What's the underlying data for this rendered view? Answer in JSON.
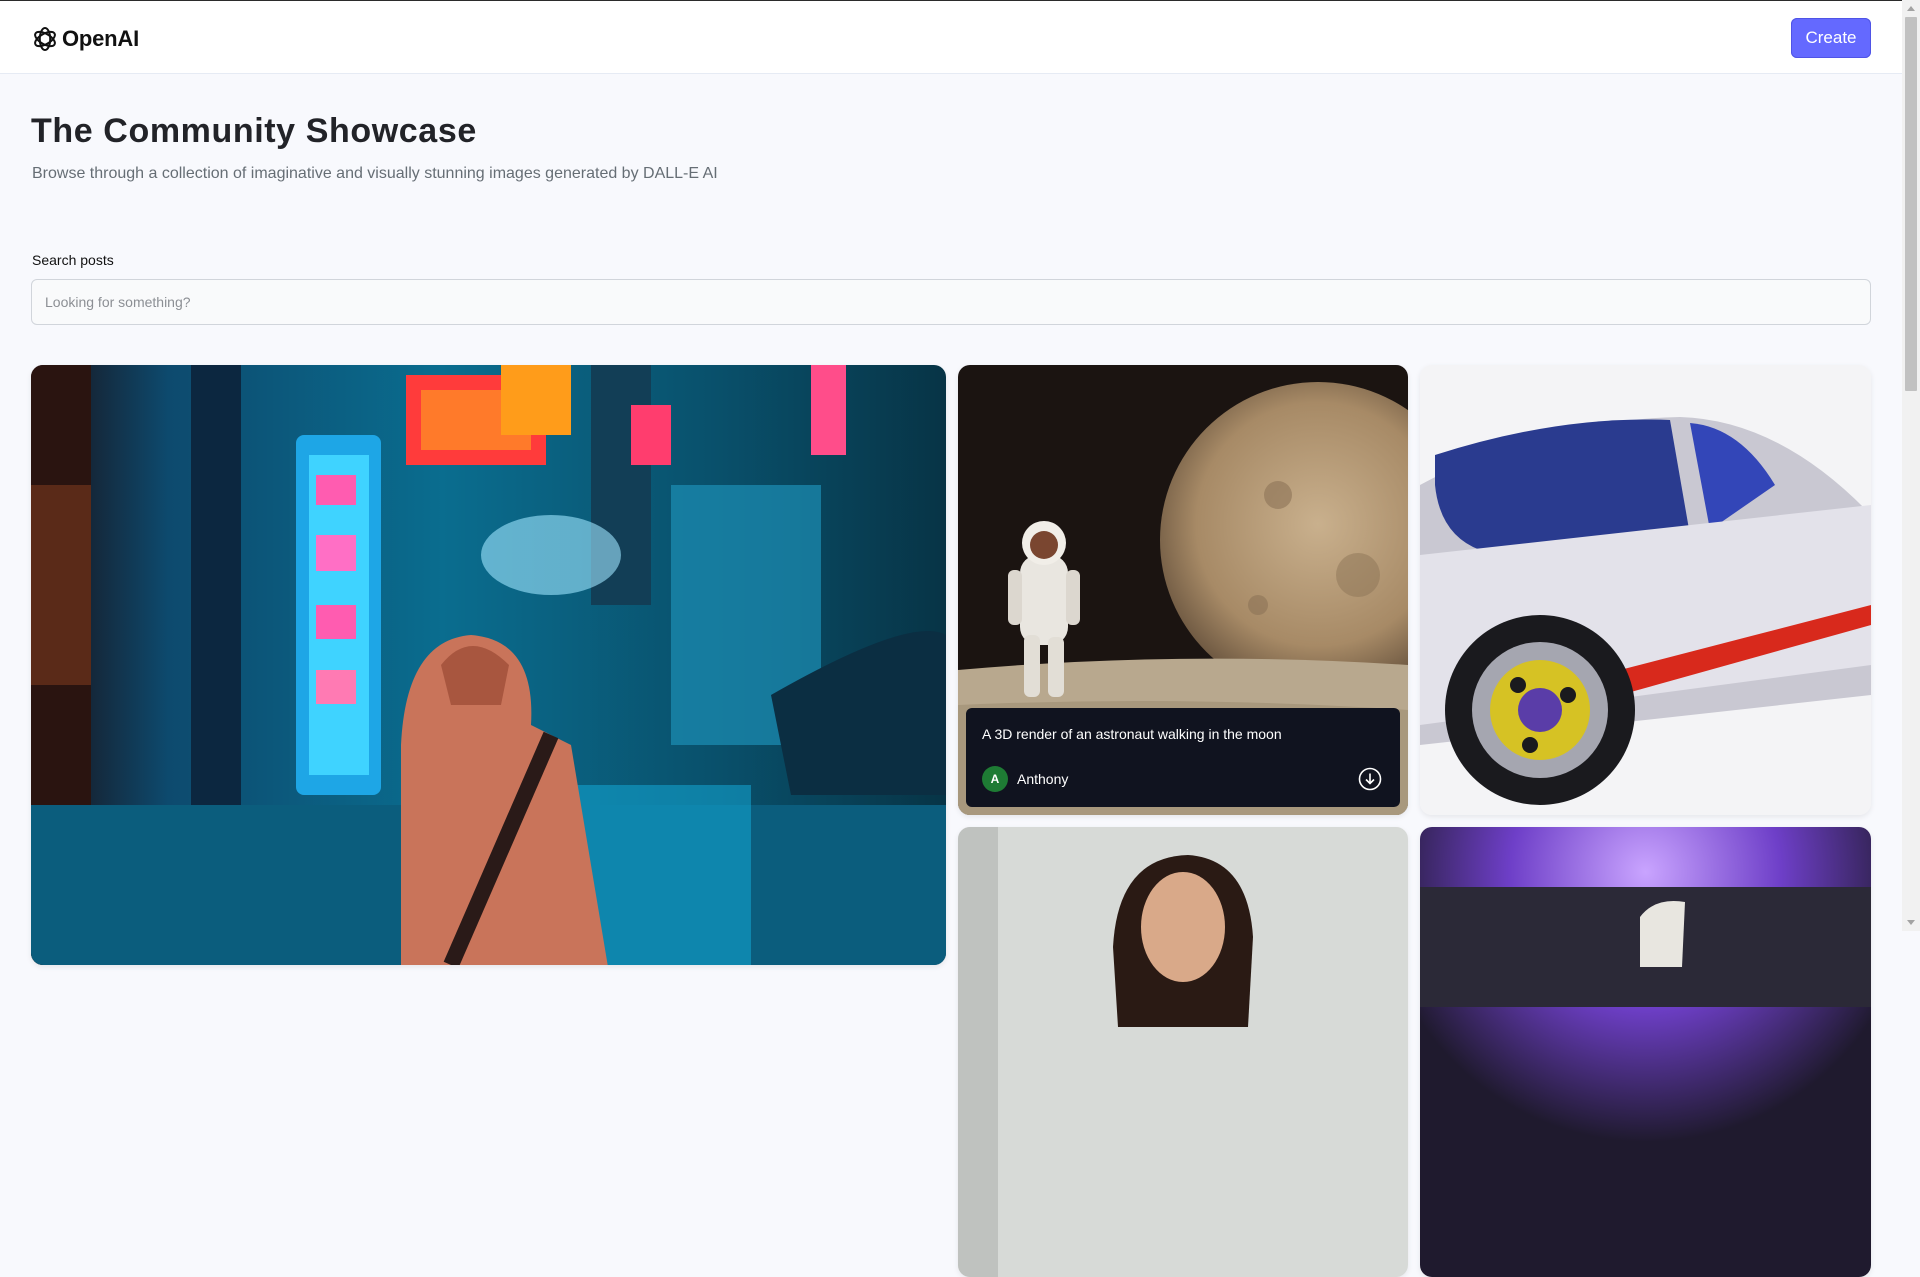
{
  "header": {
    "logo_text": "OpenAI",
    "create_label": "Create"
  },
  "hero": {
    "title": "The Community Showcase",
    "subtitle": "Browse through a collection of imaginative and visually stunning images generated by DALL-E AI"
  },
  "search": {
    "label": "Search posts",
    "placeholder": "Looking for something?",
    "value": ""
  },
  "posts": [
    {
      "image": "neon-city-street-hooded-figure"
    },
    {
      "image": "astronaut-walking-on-moon",
      "prompt": "A 3D render of an astronaut walking in the moon",
      "author": "Anthony",
      "author_initial": "A",
      "download_icon": "download-icon"
    },
    {
      "image": "silver-sports-car"
    },
    {
      "image": "woman-portrait"
    },
    {
      "image": "purple-lit-object"
    }
  ],
  "colors": {
    "accent": "#6469ff",
    "background": "#f8f9fd",
    "overlay": "#10131f",
    "avatar": "#1e7b34"
  }
}
